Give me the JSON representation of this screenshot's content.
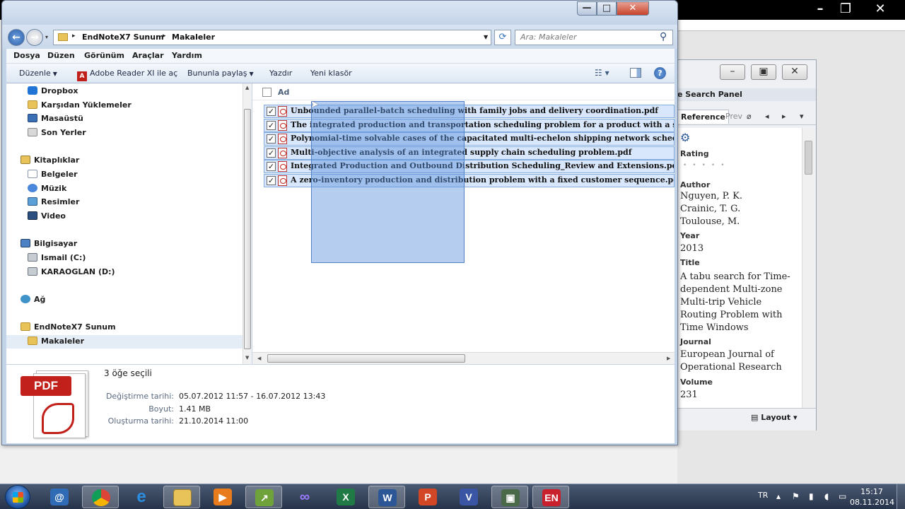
{
  "explorer": {
    "window_controls": {
      "minimize": "—",
      "maximize": "□",
      "close": "✕"
    },
    "breadcrumb": [
      "EndNoteX7 Sunum",
      "Makaleler"
    ],
    "search_placeholder": "Ara: Makaleler",
    "menu": [
      "Dosya",
      "Düzen",
      "Görünüm",
      "Araçlar",
      "Yardım"
    ],
    "toolbar": {
      "organize": "Düzenle",
      "open_with": "Adobe Reader XI ile aç",
      "share": "Bununla paylaş",
      "print": "Yazdır",
      "new_folder": "Yeni klasör"
    },
    "nav": {
      "favorites": [
        "Dropbox",
        "Karşıdan Yüklemeler",
        "Masaüstü",
        "Son Yerler"
      ],
      "libraries_title": "Kitaplıklar",
      "libraries": [
        "Belgeler",
        "Müzik",
        "Resimler",
        "Video"
      ],
      "computer_title": "Bilgisayar",
      "drives": [
        "Ismail (C:)",
        "KARAOGLAN (D:)"
      ],
      "network": "Ağ",
      "folder": "EndNoteX7 Sunum",
      "subfolder": "Makaleler"
    },
    "file_list": {
      "column_name": "Ad",
      "files": [
        "Unbounded parallel-batch scheduling with family jobs and delivery coordination.pdf",
        "The integrated production and transportation scheduling problem for a product with a short life",
        "Polynomial-time solvable cases of the capacitated multi-echelon shipping network scheduling pr",
        "Multi-objective analysis of an integrated supply chain scheduling problem.pdf",
        "Integrated Production and Outbound Distribution Scheduling_Review and Extensions.pdf",
        "A zero-inventory production and distribution problem with a fixed customer sequence.pdf"
      ]
    },
    "details": {
      "icon_text": "PDF",
      "selected": "3 öğe seçili",
      "modified_label": "Değiştirme tarihi:",
      "modified_value": "05.07.2012 11:57 - 16.07.2012 13:43",
      "size_label": "Boyut:",
      "size_value": "1.41 MB",
      "created_label": "Oluşturma tarihi:",
      "created_value": "21.10.2014 11:00"
    }
  },
  "reference_panel": {
    "title": "e Search Panel",
    "tab_reference": "Reference",
    "tab_preview": "Prev",
    "rating_label": "Rating",
    "author_label": "Author",
    "authors": [
      "Nguyen, P. K.",
      "Crainic, T. G.",
      "Toulouse, M."
    ],
    "year_label": "Year",
    "year": "2013",
    "title_label": "Title",
    "title_lines": [
      "A tabu search for Time-",
      "dependent Multi-zone",
      "Multi-trip Vehicle",
      "Routing Problem with",
      "Time Windows"
    ],
    "journal_label": "Journal",
    "journal_lines": [
      "European Journal of",
      "Operational Research"
    ],
    "volume_label": "Volume",
    "volume": "231",
    "layout_label": "Layout"
  },
  "taskbar": {
    "apps": [
      "outlook",
      "chrome",
      "internet-explorer",
      "file-explorer",
      "media-player",
      "project",
      "infinity",
      "excel",
      "word",
      "powerpoint",
      "visio",
      "remote",
      "endnote"
    ],
    "language": "TR",
    "time": "15:17",
    "date": "08.11.2014"
  },
  "colors": {
    "selection": "#d8e7fb",
    "drag_rect": "#5a91dc",
    "pdf_red": "#c2211b",
    "window_frame": "#c4d4e8"
  }
}
